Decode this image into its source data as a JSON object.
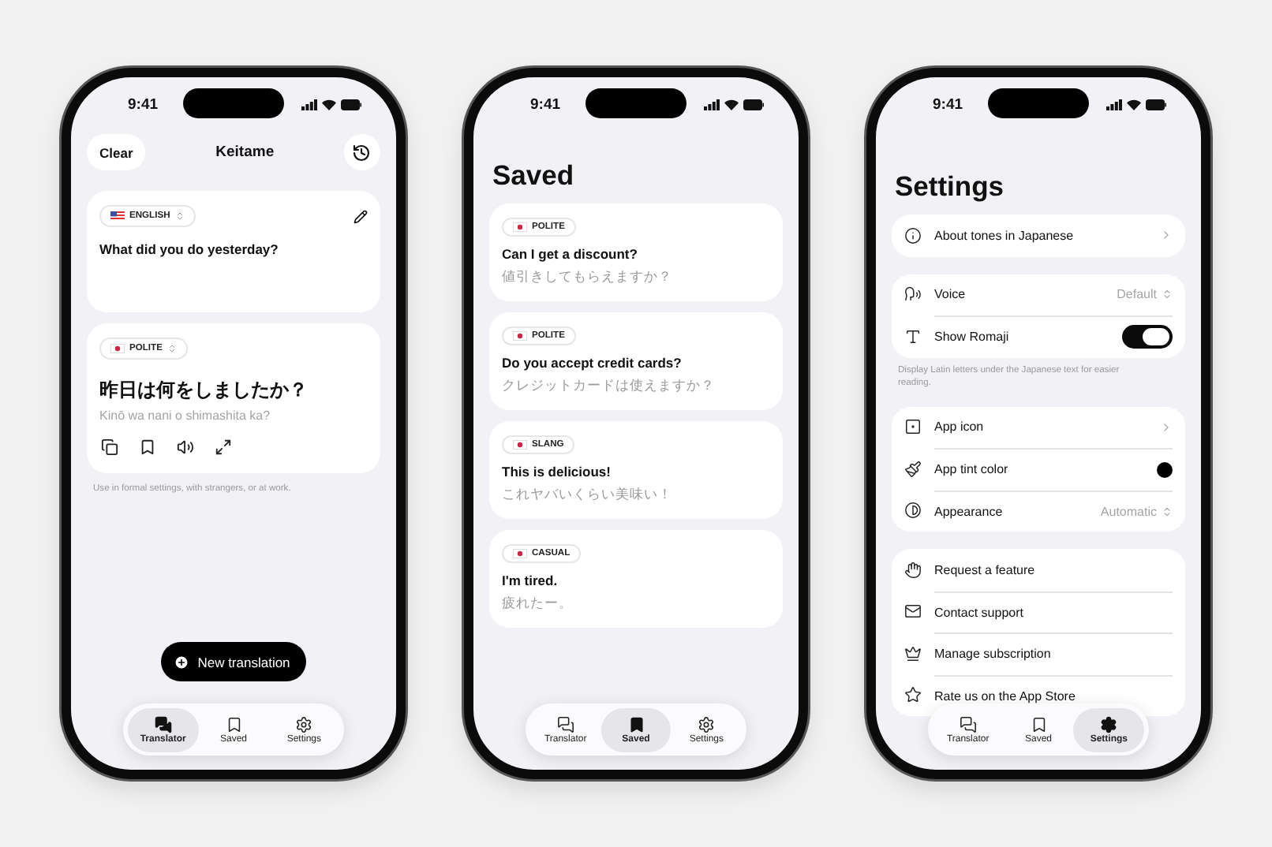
{
  "phones": [
    {
      "kind": "translator",
      "time": "9:41",
      "clear_button": "Clear",
      "title": "Keitame",
      "source": {
        "language": "ENGLISH",
        "text": "What did you do yesterday?"
      },
      "result": {
        "tone": "POLITE",
        "text": "昨日は何をしましたか？",
        "romaji": "Kinō wa nani o shimashita ka?"
      },
      "note": "Use in formal settings, with strangers, or at work.",
      "action_button": "New translation",
      "tabs": [
        {
          "label": "Translator",
          "selected": true
        },
        {
          "label": "Saved",
          "selected": false
        },
        {
          "label": "Settings",
          "selected": false
        }
      ]
    },
    {
      "kind": "saved",
      "time": "9:41",
      "title": "Saved",
      "items": [
        {
          "tone": "POLITE",
          "english": "Can I get a discount?",
          "japanese": "値引きしてもらえますか？"
        },
        {
          "tone": "POLITE",
          "english": "Do you accept credit cards?",
          "japanese": "クレジットカードは使えますか？"
        },
        {
          "tone": "SLANG",
          "english": "This is delicious!",
          "japanese": "これヤバいくらい美味い！"
        },
        {
          "tone": "CASUAL",
          "english": "I'm tired.",
          "japanese": "疲れたー。"
        }
      ],
      "tabs": [
        {
          "label": "Translator",
          "selected": false
        },
        {
          "label": "Saved",
          "selected": true
        },
        {
          "label": "Settings",
          "selected": false
        }
      ]
    },
    {
      "kind": "settings",
      "time": "9:41",
      "title": "Settings",
      "groups": [
        {
          "rows": [
            {
              "kind": "link",
              "label": "About tones in Japanese"
            }
          ]
        },
        {
          "rows": [
            {
              "kind": "select",
              "label": "Voice",
              "value": "Default"
            },
            {
              "kind": "toggle",
              "label": "Show Romaji",
              "on": true
            }
          ],
          "footnote": "Display Latin letters under the Japanese text for easier reading."
        },
        {
          "rows": [
            {
              "kind": "link",
              "label": "App icon"
            },
            {
              "kind": "color",
              "label": "App tint color",
              "color": "#000000"
            },
            {
              "kind": "select",
              "label": "Appearance",
              "value": "Automatic"
            }
          ]
        },
        {
          "rows": [
            {
              "kind": "plain",
              "label": "Request a feature"
            },
            {
              "kind": "plain",
              "label": "Contact support"
            },
            {
              "kind": "plain",
              "label": "Manage subscription"
            },
            {
              "kind": "plain",
              "label": "Rate us on the App Store"
            }
          ]
        }
      ],
      "tabs": [
        {
          "label": "Translator",
          "selected": false
        },
        {
          "label": "Saved",
          "selected": false
        },
        {
          "label": "Settings",
          "selected": true
        }
      ]
    }
  ]
}
